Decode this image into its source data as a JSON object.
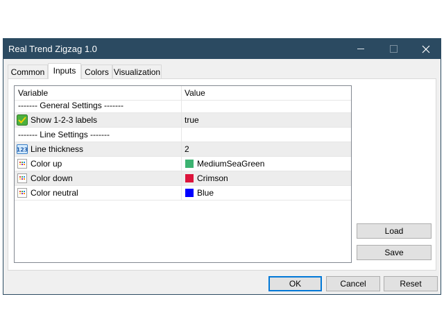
{
  "window": {
    "title": "Real Trend Zigzag 1.0"
  },
  "tabs": [
    {
      "label": "Common",
      "active": false
    },
    {
      "label": "Inputs",
      "active": true
    },
    {
      "label": "Colors",
      "active": false
    },
    {
      "label": "Visualization",
      "active": false
    }
  ],
  "table": {
    "columns": [
      "Variable",
      "Value"
    ],
    "rows": [
      {
        "variable": "------- General Settings -------",
        "value": "",
        "icon": "none"
      },
      {
        "variable": "Show 1-2-3 labels",
        "value": "true",
        "icon": "boolean-icon"
      },
      {
        "variable": "------- Line Settings -------",
        "value": "",
        "icon": "none"
      },
      {
        "variable": "Line thickness",
        "value": "2",
        "icon": "integer-icon"
      },
      {
        "variable": "Color up",
        "value": "MediumSeaGreen",
        "icon": "color-palette-icon",
        "swatch": "#3cb371"
      },
      {
        "variable": "Color down",
        "value": "Crimson",
        "icon": "color-palette-icon",
        "swatch": "#dc143c"
      },
      {
        "variable": "Color neutral",
        "value": "Blue",
        "icon": "color-palette-icon",
        "swatch": "#0000ff"
      }
    ]
  },
  "side_buttons": {
    "load_label": "Load",
    "save_label": "Save"
  },
  "footer": {
    "ok_label": "OK",
    "cancel_label": "Cancel",
    "reset_label": "Reset"
  },
  "colors": {
    "titlebar": "#2b4a61",
    "accent": "#0078d7"
  }
}
